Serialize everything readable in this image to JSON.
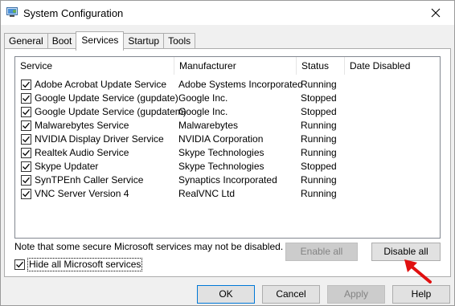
{
  "window": {
    "title": "System Configuration",
    "accent_color": "#0078d7"
  },
  "tabs": [
    {
      "label": "General",
      "active": false
    },
    {
      "label": "Boot",
      "active": false
    },
    {
      "label": "Services",
      "active": true
    },
    {
      "label": "Startup",
      "active": false
    },
    {
      "label": "Tools",
      "active": false
    }
  ],
  "services": {
    "columns": [
      "Service",
      "Manufacturer",
      "Status",
      "Date Disabled"
    ],
    "rows": [
      {
        "checked": true,
        "service": "Adobe Acrobat Update Service",
        "manufacturer": "Adobe Systems Incorporated",
        "status": "Running",
        "date_disabled": ""
      },
      {
        "checked": true,
        "service": "Google Update Service (gupdate)",
        "manufacturer": "Google Inc.",
        "status": "Stopped",
        "date_disabled": ""
      },
      {
        "checked": true,
        "service": "Google Update Service (gupdatem)",
        "manufacturer": "Google Inc.",
        "status": "Stopped",
        "date_disabled": ""
      },
      {
        "checked": true,
        "service": "Malwarebytes Service",
        "manufacturer": "Malwarebytes",
        "status": "Running",
        "date_disabled": ""
      },
      {
        "checked": true,
        "service": "NVIDIA Display Driver Service",
        "manufacturer": "NVIDIA Corporation",
        "status": "Running",
        "date_disabled": ""
      },
      {
        "checked": true,
        "service": "Realtek Audio Service",
        "manufacturer": "Skype Technologies",
        "status": "Running",
        "date_disabled": ""
      },
      {
        "checked": true,
        "service": "Skype Updater",
        "manufacturer": "Skype Technologies",
        "status": "Stopped",
        "date_disabled": ""
      },
      {
        "checked": true,
        "service": "SynTPEnh Caller Service",
        "manufacturer": "Synaptics Incorporated",
        "status": "Running",
        "date_disabled": ""
      },
      {
        "checked": true,
        "service": "VNC Server Version 4",
        "manufacturer": "RealVNC Ltd",
        "status": "Running",
        "date_disabled": ""
      }
    ],
    "note": "Note that some secure Microsoft services may not be disabled.",
    "enable_all_label": "Enable all",
    "disable_all_label": "Disable all",
    "hide_ms_label": "Hide all Microsoft services",
    "hide_ms_checked": true
  },
  "footer": {
    "ok_label": "OK",
    "cancel_label": "Cancel",
    "apply_label": "Apply",
    "help_label": "Help"
  },
  "annotation": {
    "arrow_color": "#e01010",
    "arrow_icon": "red-arrow-icon"
  }
}
